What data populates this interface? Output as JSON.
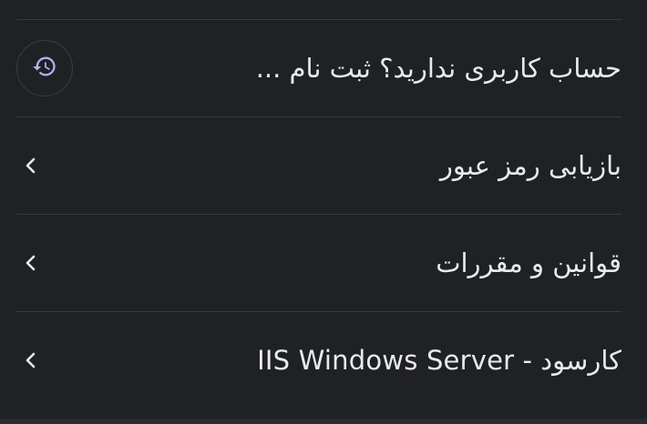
{
  "items": [
    {
      "label": "حساب کاربری ندارید؟ ثبت نام ...",
      "icon": "history-icon"
    },
    {
      "label": "بازیابی رمز عبور",
      "icon": "chevron-left-icon"
    },
    {
      "label": "قوانین و مقررات",
      "icon": "chevron-left-icon"
    },
    {
      "label": "کارسود - IIS Windows Server",
      "icon": "chevron-left-icon"
    }
  ],
  "colors": {
    "background": "#202124",
    "text": "#e8eaed",
    "accent": "#aab4f5",
    "divider": "#3a3b3e"
  }
}
